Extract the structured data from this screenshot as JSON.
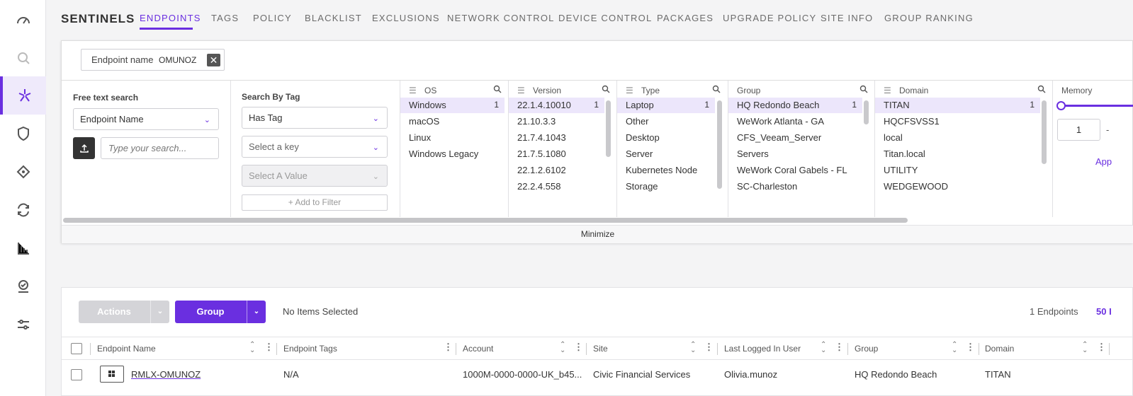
{
  "brand": "SENTINELS",
  "tabs": [
    "ENDPOINTS",
    "TAGS",
    "POLICY",
    "BLACKLIST",
    "EXCLUSIONS",
    "NETWORK CONTROL",
    "DEVICE CONTROL",
    "PACKAGES",
    "UPGRADE POLICY",
    "SITE INFO",
    "GROUP RANKING"
  ],
  "chip": {
    "label": "Endpoint name",
    "value": "OMUNOZ",
    "remove": "✕"
  },
  "free_text": {
    "label": "Free text search",
    "select": "Endpoint Name",
    "placeholder": "Type your search..."
  },
  "by_tag": {
    "label": "Search By Tag",
    "has_tag": "Has Tag",
    "key_placeholder": "Select a key",
    "value_placeholder": "Select A Value",
    "add_button": "Add to Filter"
  },
  "os": {
    "title": "OS",
    "items": [
      {
        "label": "Windows",
        "count": "1"
      },
      {
        "label": "macOS"
      },
      {
        "label": "Linux"
      },
      {
        "label": "Windows Legacy"
      }
    ]
  },
  "version": {
    "title": "Version",
    "items": [
      {
        "label": "22.1.4.10010",
        "count": "1"
      },
      {
        "label": "21.10.3.3"
      },
      {
        "label": "21.7.4.1043"
      },
      {
        "label": "21.7.5.1080"
      },
      {
        "label": "22.1.2.6102"
      },
      {
        "label": "22.2.4.558"
      }
    ]
  },
  "type": {
    "title": "Type",
    "items": [
      {
        "label": "Laptop",
        "count": "1"
      },
      {
        "label": "Other"
      },
      {
        "label": "Desktop"
      },
      {
        "label": "Server"
      },
      {
        "label": "Kubernetes Node"
      },
      {
        "label": "Storage"
      }
    ]
  },
  "group": {
    "title": "Group",
    "items": [
      {
        "label": "HQ Redondo Beach",
        "count": "1"
      },
      {
        "label": "WeWork Atlanta - GA"
      },
      {
        "label": "CFS_Veeam_Server"
      },
      {
        "label": "Servers"
      },
      {
        "label": "WeWork Coral Gabels - FL"
      },
      {
        "label": "SC-Charleston"
      }
    ]
  },
  "domain": {
    "title": "Domain",
    "items": [
      {
        "label": "TITAN",
        "count": "1"
      },
      {
        "label": "HQCFSVSS1"
      },
      {
        "label": "local"
      },
      {
        "label": "Titan.local"
      },
      {
        "label": "UTILITY"
      },
      {
        "label": "WEDGEWOOD"
      }
    ]
  },
  "memory": {
    "title": "Memory",
    "min": "1",
    "dash": "-",
    "apply": "App"
  },
  "minimize": "Minimize",
  "actions": {
    "label": "Actions",
    "group": "Group",
    "no_items": "No Items Selected",
    "count": "1 Endpoints",
    "per_page": "50 I"
  },
  "columns": [
    "Endpoint Name",
    "Endpoint Tags",
    "Account",
    "Site",
    "Last Logged In User",
    "Group",
    "Domain"
  ],
  "row": {
    "endpoint_name": "RMLX-OMUNOZ",
    "tags": "N/A",
    "account": "1000M-0000-0000-UK_b45...",
    "site": "Civic Financial Services",
    "user": "Olivia.munoz",
    "group": "HQ Redondo Beach",
    "domain": "TITAN"
  },
  "colors": {
    "accent": "#6a2fe0",
    "selected_row": "#ece6fb"
  }
}
